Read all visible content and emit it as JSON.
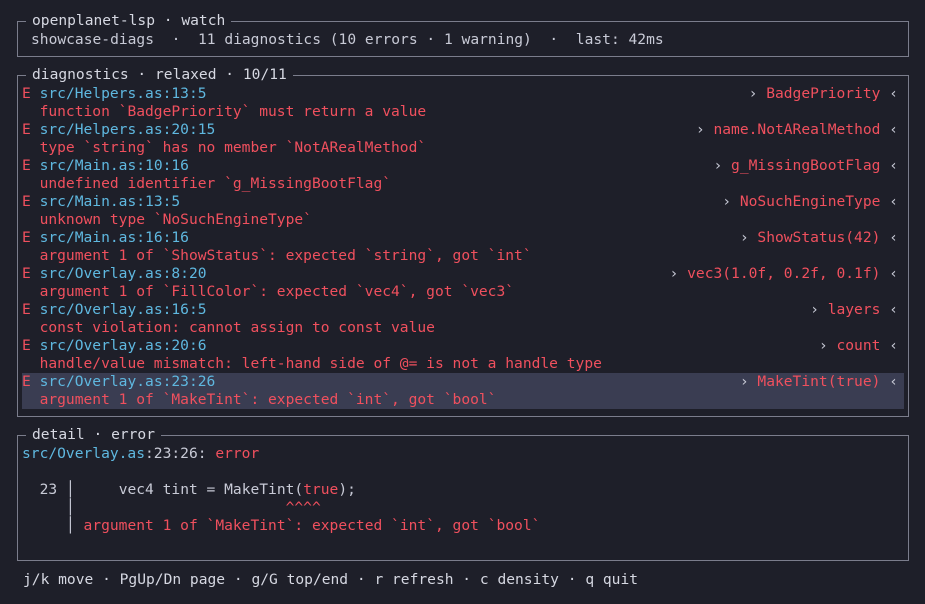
{
  "header": {
    "title": "openplanet-lsp · watch",
    "project": "showcase-diags",
    "summary": "11 diagnostics (10 errors · 1 warning)",
    "last": "last: 42ms",
    "sep": "·"
  },
  "diagnostics": {
    "title": "diagnostics · relaxed · 10/11",
    "items": [
      {
        "sev": "E",
        "loc": "src/Helpers.as:13:5",
        "symbol": "BadgePriority",
        "message": "function `BadgePriority` must return a value"
      },
      {
        "sev": "E",
        "loc": "src/Helpers.as:20:15",
        "symbol": "name.NotARealMethod",
        "message": "type `string` has no member `NotARealMethod`"
      },
      {
        "sev": "E",
        "loc": "src/Main.as:10:16",
        "symbol": "g_MissingBootFlag",
        "message": "undefined identifier `g_MissingBootFlag`"
      },
      {
        "sev": "E",
        "loc": "src/Main.as:13:5",
        "symbol": "NoSuchEngineType",
        "message": "unknown type `NoSuchEngineType`"
      },
      {
        "sev": "E",
        "loc": "src/Main.as:16:16",
        "symbol": "ShowStatus(42)",
        "message": "argument 1 of `ShowStatus`: expected `string`, got `int`"
      },
      {
        "sev": "E",
        "loc": "src/Overlay.as:8:20",
        "symbol": "vec3(1.0f, 0.2f, 0.1f)",
        "message": "argument 1 of `FillColor`: expected `vec4`, got `vec3`"
      },
      {
        "sev": "E",
        "loc": "src/Overlay.as:16:5",
        "symbol": "layers",
        "message": "const violation: cannot assign to const value"
      },
      {
        "sev": "E",
        "loc": "src/Overlay.as:20:6",
        "symbol": "count",
        "message": "handle/value mismatch: left-hand side of @= is not a handle type"
      },
      {
        "sev": "E",
        "loc": "src/Overlay.as:23:26",
        "symbol": "MakeTint(true)",
        "message": "argument 1 of `MakeTint`: expected `int`, got `bool`",
        "selected": true
      }
    ]
  },
  "detail": {
    "title": "detail · error",
    "file": "src/Overlay.as",
    "pos": ":23:26: ",
    "severity": "error",
    "line_no": "23",
    "code_before": "    vec4 tint = MakeTint(",
    "code_highlight": "true",
    "code_after": ");",
    "caret": "^^^^",
    "message": "argument 1 of `MakeTint`: expected `int`, got `bool`"
  },
  "footer": {
    "help": "j/k move · PgUp/Dn page · g/G top/end · r refresh · c density · q quit"
  },
  "colors": {
    "background": "#1e1f29",
    "error": "#f0505e",
    "path": "#5fb8e0",
    "selection": "#3a3d52"
  }
}
